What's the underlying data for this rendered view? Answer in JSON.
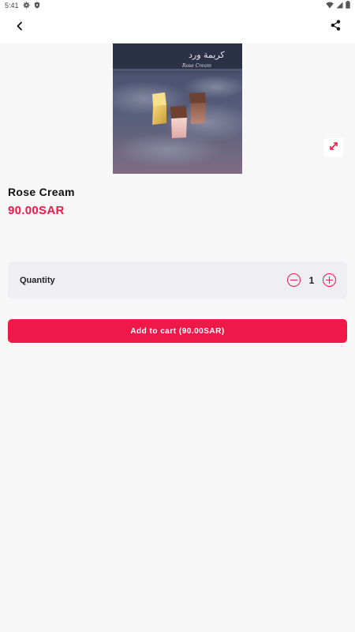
{
  "status_bar": {
    "time": "5:41",
    "icons": [
      "gear-icon",
      "shield-icon",
      "wifi-icon",
      "signal-icon",
      "battery-icon"
    ]
  },
  "top_bar": {
    "back_icon": "chevron-left-icon",
    "share_icon": "share-icon"
  },
  "product": {
    "image_caption": "Rose Cream",
    "image_title_ar": "كريمة ورد",
    "name": "Rose Cream",
    "price": "90.00SAR",
    "expand_icon": "expand-icon"
  },
  "quantity": {
    "label": "Quantity",
    "value": "1",
    "decrement_icon": "minus-circle-icon",
    "increment_icon": "plus-circle-icon"
  },
  "cart": {
    "button_label": "Add to cart (90.00SAR)"
  },
  "colors": {
    "accent": "#f01848",
    "background": "#f7f7f8",
    "card": "#efeef3"
  }
}
